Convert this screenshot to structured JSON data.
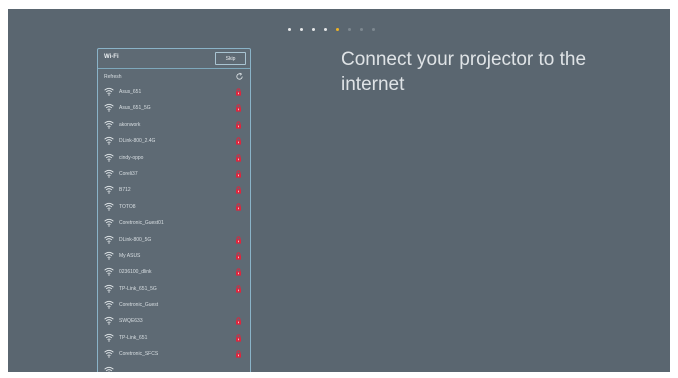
{
  "progress": {
    "total_steps": 8,
    "current_step": 5
  },
  "wifi_panel": {
    "title": "Wi-Fi",
    "skip_label": "Skip",
    "refresh_label": "Refresh",
    "networks": [
      {
        "name": "Asus_651",
        "locked": true
      },
      {
        "name": "Asus_651_5G",
        "locked": true
      },
      {
        "name": "akonwork",
        "locked": true
      },
      {
        "name": "DLink-800_2.4G",
        "locked": true
      },
      {
        "name": "cindy-oppo",
        "locked": true
      },
      {
        "name": "Coreli37",
        "locked": true
      },
      {
        "name": "B712",
        "locked": true
      },
      {
        "name": "TOTO8",
        "locked": true
      },
      {
        "name": "Coretronic_Guest01",
        "locked": false
      },
      {
        "name": "DLink-800_5G",
        "locked": true
      },
      {
        "name": "My ASUS",
        "locked": true
      },
      {
        "name": "0236100_dlink",
        "locked": true
      },
      {
        "name": "TP-Link_651_5G",
        "locked": true
      },
      {
        "name": "Coretronic_Guest",
        "locked": false
      },
      {
        "name": "SWQE633",
        "locked": true
      },
      {
        "name": "TP-Link_651",
        "locked": true
      },
      {
        "name": "Coretronic_SFCS",
        "locked": true
      },
      {
        "name": "",
        "locked": false
      }
    ]
  },
  "main": {
    "heading": "Connect your projector to the internet"
  },
  "colors": {
    "background": "#5a6670",
    "accent": "#f0b323",
    "lock": "#e0243c",
    "panel_border": "#8ab3c8"
  }
}
